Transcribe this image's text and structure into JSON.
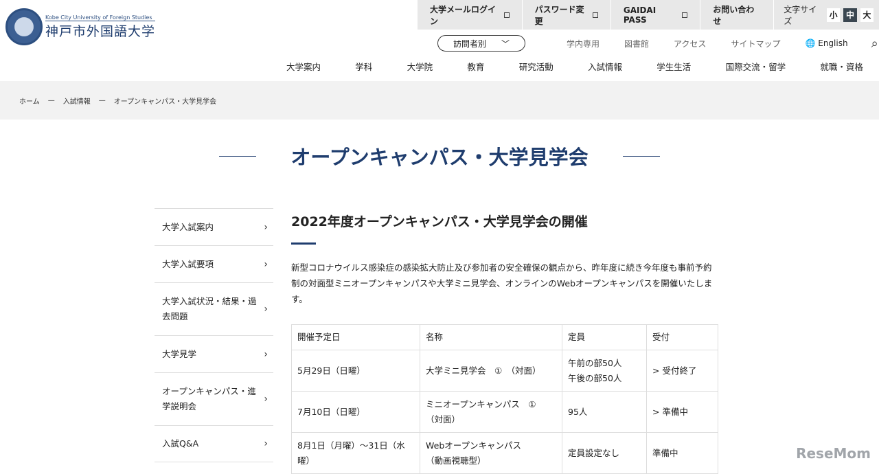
{
  "logo": {
    "en": "Kobe City University of Foreign Studies",
    "ja": "神戸市外国語大学"
  },
  "util": {
    "mail": "大学メールログイン",
    "password": "パスワード変更",
    "gaidai": "GAIDAI PASS",
    "contact": "お問い合わせ",
    "font_size_label": "文字サイズ",
    "sizes": [
      "小",
      "中",
      "大"
    ],
    "active_size": "中"
  },
  "row2": {
    "visitor": "訪問者別",
    "links": [
      "学内専用",
      "図書館",
      "アクセス",
      "サイトマップ"
    ],
    "english": "English"
  },
  "nav": [
    "大学案内",
    "学科",
    "大学院",
    "教育",
    "研究活動",
    "入試情報",
    "学生生活",
    "国際交流・留学",
    "就職・資格"
  ],
  "breadcrumb": [
    "ホーム",
    "入試情報",
    "オープンキャンパス・大学見学会"
  ],
  "breadcrumb_sep": "—",
  "page_title": "オープンキャンパス・大学見学会",
  "sidebar": [
    {
      "l1": "大学入試案内"
    },
    {
      "l1": "大学入試要項"
    },
    {
      "l1": "大学入試状況・結果・過",
      "l2": "去問題"
    },
    {
      "l1": "大学見学"
    },
    {
      "l1": "オープンキャンパス・進",
      "l2": "学説明会"
    },
    {
      "l1": "入試Q&A"
    }
  ],
  "content": {
    "heading": "2022年度オープンキャンパス・大学見学会の開催",
    "intro": "新型コロナウイルス感染症の感染拡大防止及び参加者の安全確保の観点から、昨年度に続き今年度も事前予約制の対面型ミニオープンキャンパスや大学ミニ見学会、オンラインのWebオープンキャンパスを開催いたします。",
    "table": {
      "headers": [
        "開催予定日",
        "名称",
        "定員",
        "受付"
      ],
      "rows": [
        {
          "date": "5月29日（日曜）",
          "name1": "大学ミニ見学会　①　（対面）",
          "name2": "",
          "cap1": "午前の部50人",
          "cap2": "午後の部50人",
          "status": "> 受付終了"
        },
        {
          "date": "7月10日（日曜）",
          "name1": "ミニオープンキャンパス　①",
          "name2": "（対面）",
          "cap1": "95人",
          "cap2": "",
          "status": "> 準備中"
        },
        {
          "date": "8月1日（月曜）～31日（水曜）",
          "name1": "Webオープンキャンパス",
          "name2": "（動画視聴型）",
          "cap1": "定員設定なし",
          "cap2": "",
          "status": "準備中"
        }
      ]
    }
  },
  "watermark": "ReseMom"
}
